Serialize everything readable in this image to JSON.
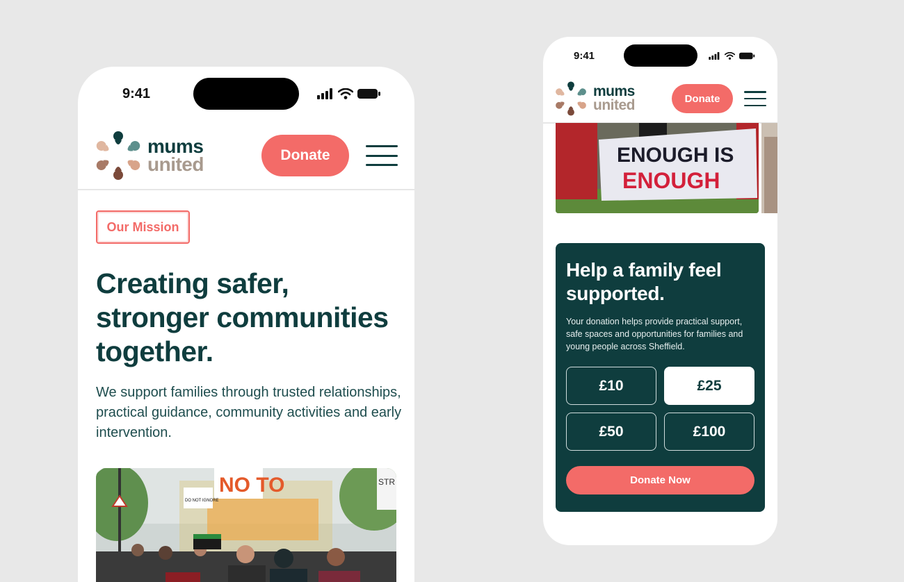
{
  "left_phone": {
    "status": {
      "time": "9:41"
    },
    "logo": {
      "line1": "mums",
      "line2": "united"
    },
    "nav": {
      "donate_label": "Donate"
    },
    "badge": "Our Mission",
    "title": "Creating safer, stronger communities together.",
    "description": "We support families through trusted relationships, practical guidance, community activities and early intervention.",
    "photo_signs": [
      "NO TO",
      "DO NOT IGNORE",
      "STR"
    ]
  },
  "right_phone": {
    "status": {
      "time": "9:41"
    },
    "logo": {
      "line1": "mums",
      "line2": "united"
    },
    "nav": {
      "donate_label": "Donate"
    },
    "banner": {
      "line1": "ENOUGH IS",
      "line2": "ENOUGH"
    },
    "card": {
      "title": "Help a family feel supported.",
      "description": "Your donation helps provide practical support, safe spaces and opportunities for families and young people across Sheffield.",
      "amounts": [
        "£10",
        "£25",
        "£50",
        "£100"
      ],
      "selected_amount": "£25",
      "cta": "Donate Now"
    }
  },
  "colors": {
    "background": "#e8e8e8",
    "brand_dark": "#0f3d3e",
    "accent": "#f36b68",
    "logo_muted": "#a89a8e"
  }
}
